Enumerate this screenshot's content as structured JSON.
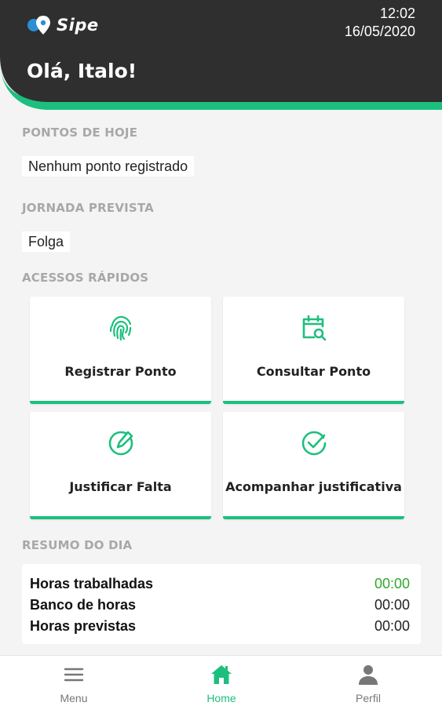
{
  "header": {
    "app_name": "Sipe",
    "time": "12:02",
    "date": "16/05/2020",
    "greeting": "Olá, Italo!"
  },
  "today": {
    "title": "PONTOS DE HOJE",
    "value": "Nenhum ponto registrado"
  },
  "schedule": {
    "title": "JORNADA PREVISTA",
    "value": "Folga"
  },
  "quick_access": {
    "title": "ACESSOS RÁPIDOS",
    "items": [
      {
        "label": "Registrar Ponto",
        "icon": "fingerprint-icon"
      },
      {
        "label": "Consultar Ponto",
        "icon": "calendar-search-icon"
      },
      {
        "label": "Justificar Falta",
        "icon": "edit-circle-icon"
      },
      {
        "label": "Acompanhar justificativa",
        "icon": "check-circle-icon"
      }
    ]
  },
  "summary": {
    "title": "RESUMO DO DIA",
    "rows": [
      {
        "label": "Horas trabalhadas",
        "value": "00:00"
      },
      {
        "label": "Banco de horas",
        "value": "00:00"
      },
      {
        "label": "Horas previstas",
        "value": "00:00"
      }
    ]
  },
  "nav": {
    "items": [
      {
        "label": "Menu",
        "icon": "menu-icon"
      },
      {
        "label": "Home",
        "icon": "home-icon"
      },
      {
        "label": "Perfil",
        "icon": "user-icon"
      }
    ],
    "active": "Home"
  },
  "colors": {
    "header_bg": "#2f2f2f",
    "accent": "#1dbf7e",
    "logo_blue": "#2b8fd6",
    "positive_value": "#2ea82e"
  }
}
